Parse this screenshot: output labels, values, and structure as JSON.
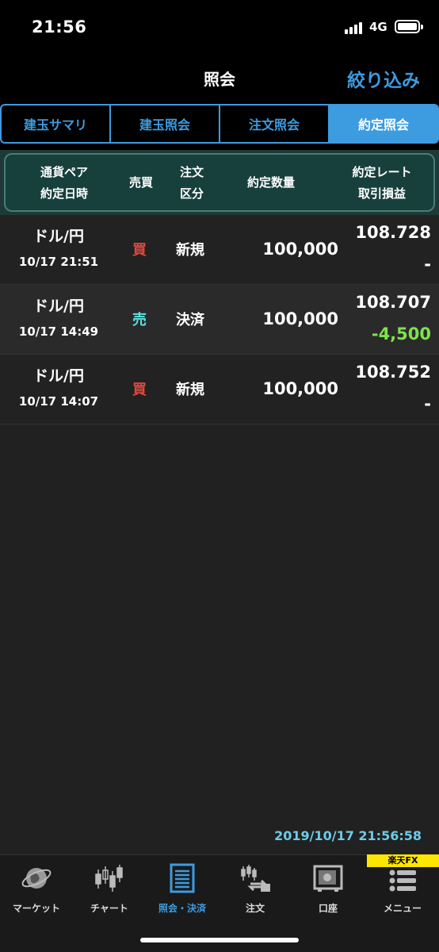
{
  "status_bar": {
    "time": "21:56",
    "network": "4G"
  },
  "nav": {
    "title": "照会",
    "filter_label": "絞り込み"
  },
  "tabs": [
    {
      "label": "建玉サマリ",
      "active": false
    },
    {
      "label": "建玉照会",
      "active": false
    },
    {
      "label": "注文照会",
      "active": false
    },
    {
      "label": "約定照会",
      "active": true
    }
  ],
  "table_header": {
    "pair_line1": "通貨ペア",
    "pair_line2": "約定日時",
    "side": "売買",
    "order_type_line1": "注文",
    "order_type_line2": "区分",
    "quantity": "約定数量",
    "rate_line1": "約定レート",
    "rate_line2": "取引損益"
  },
  "rows": [
    {
      "pair": "ドル/円",
      "datetime": "10/17 21:51",
      "side": "買",
      "side_kind": "buy",
      "order_type": "新規",
      "quantity": "100,000",
      "rate": "108.728",
      "pl": "-"
    },
    {
      "pair": "ドル/円",
      "datetime": "10/17 14:49",
      "side": "売",
      "side_kind": "sell",
      "order_type": "決済",
      "quantity": "100,000",
      "rate": "108.707",
      "pl": "-4,500"
    },
    {
      "pair": "ドル/円",
      "datetime": "10/17 14:07",
      "side": "買",
      "side_kind": "buy",
      "order_type": "新規",
      "quantity": "100,000",
      "rate": "108.752",
      "pl": "-"
    }
  ],
  "timestamp": "2019/10/17 21:56:58",
  "bottom_tabs": [
    {
      "label": "マーケット",
      "icon": "globe-icon",
      "active": false
    },
    {
      "label": "チャート",
      "icon": "candlestick-icon",
      "active": false
    },
    {
      "label": "照会・決済",
      "icon": "document-list-icon",
      "active": true
    },
    {
      "label": "注文",
      "icon": "order-exchange-icon",
      "active": false
    },
    {
      "label": "口座",
      "icon": "safe-icon",
      "active": false
    },
    {
      "label": "メニュー",
      "icon": "menu-list-icon",
      "active": false
    }
  ],
  "brand_badge": "楽天FX",
  "colors": {
    "accent": "#3d9be0",
    "buy": "#e0483d",
    "sell": "#5fe0e0",
    "profit": "#7ee34c",
    "timestamp": "#6ecbe6"
  }
}
